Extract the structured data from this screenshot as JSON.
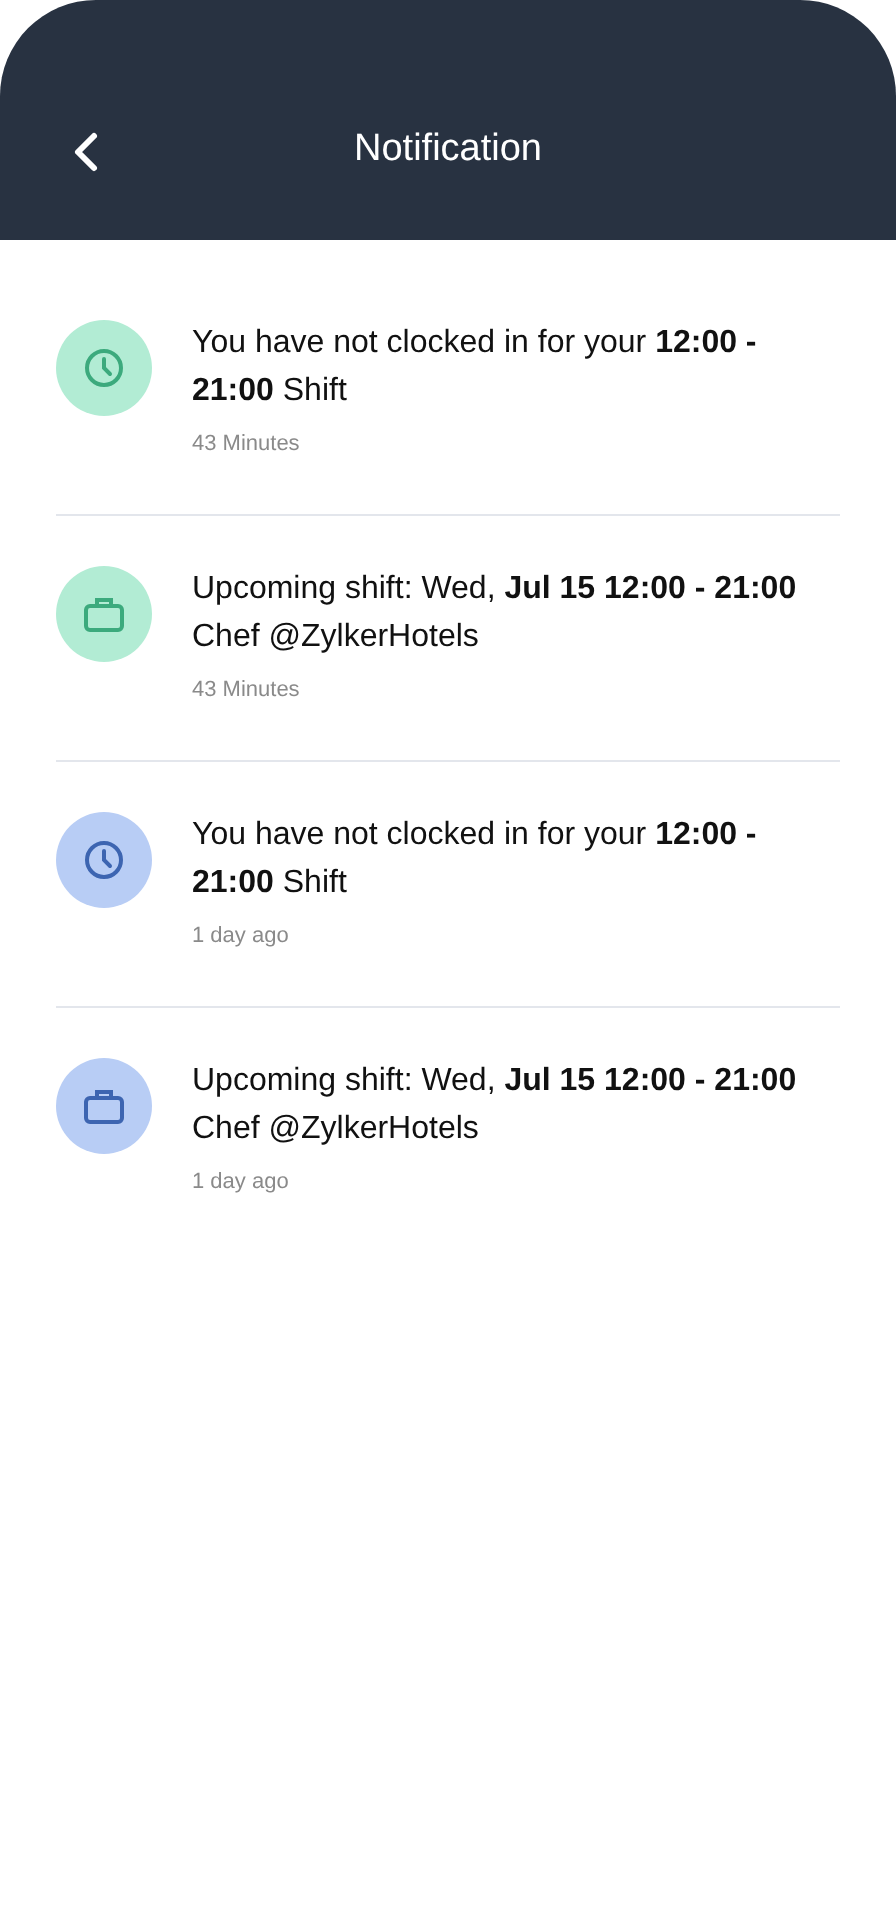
{
  "header": {
    "title": "Notification"
  },
  "notifications": [
    {
      "kind": "clock",
      "color": "#b2ecd4",
      "message": "You have not clocked in for your **12:00 - 21:00** Shift",
      "time": "43 Minutes"
    },
    {
      "kind": "bag",
      "color": "#b2ecd4",
      "message": "Upcoming shift: Wed, **Jul 15 12:00 - 21:00** Chef @ZylkerHotels",
      "time": "43 Minutes"
    },
    {
      "kind": "clock",
      "color": "#b8cdf5",
      "message": "You have not clocked in for your **12:00 - 21:00** Shift",
      "time": "1 day ago"
    },
    {
      "kind": "bag",
      "color": "#b8cdf5",
      "message": "Upcoming shift: Wed, **Jul 15 12:00 - 21:00** Chef @ZylkerHotels",
      "time": "1 day ago"
    }
  ]
}
